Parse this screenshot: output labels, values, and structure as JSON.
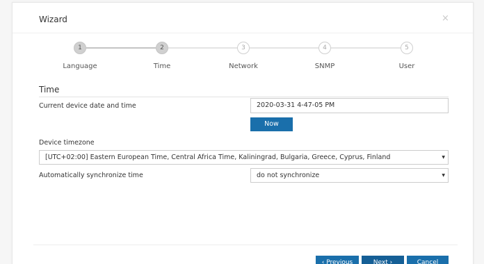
{
  "dialog": {
    "title": "Wizard",
    "close_glyph": "×"
  },
  "stepper": {
    "steps": [
      {
        "number": "1",
        "label": "Language",
        "state": "completed"
      },
      {
        "number": "2",
        "label": "Time",
        "state": "current"
      },
      {
        "number": "3",
        "label": "Network",
        "state": "pending"
      },
      {
        "number": "4",
        "label": "SNMP",
        "state": "pending"
      },
      {
        "number": "5",
        "label": "User",
        "state": "pending"
      }
    ]
  },
  "time_section": {
    "title": "Time",
    "current_datetime": {
      "label": "Current device date and time",
      "value": "2020-03-31 4-47-05 PM"
    },
    "now_button": "Now",
    "timezone": {
      "label": "Device timezone",
      "selected": "[UTC+02:00] Eastern European Time, Central Africa Time, Kaliningrad, Bulgaria, Greece, Cyprus, Finland"
    },
    "auto_sync": {
      "label": "Automatically synchronize time",
      "selected": "do not synchronize"
    }
  },
  "footer": {
    "previous": "‹ Previous",
    "next": "Next ›",
    "cancel": "Cancel"
  },
  "colors": {
    "primary_button": "#1a6fab",
    "step_done": "#d0d0d0",
    "step_pending_border": "#cfcfcf"
  },
  "icons": {
    "close": "close-icon",
    "dropdown": "chevron-down-icon"
  }
}
